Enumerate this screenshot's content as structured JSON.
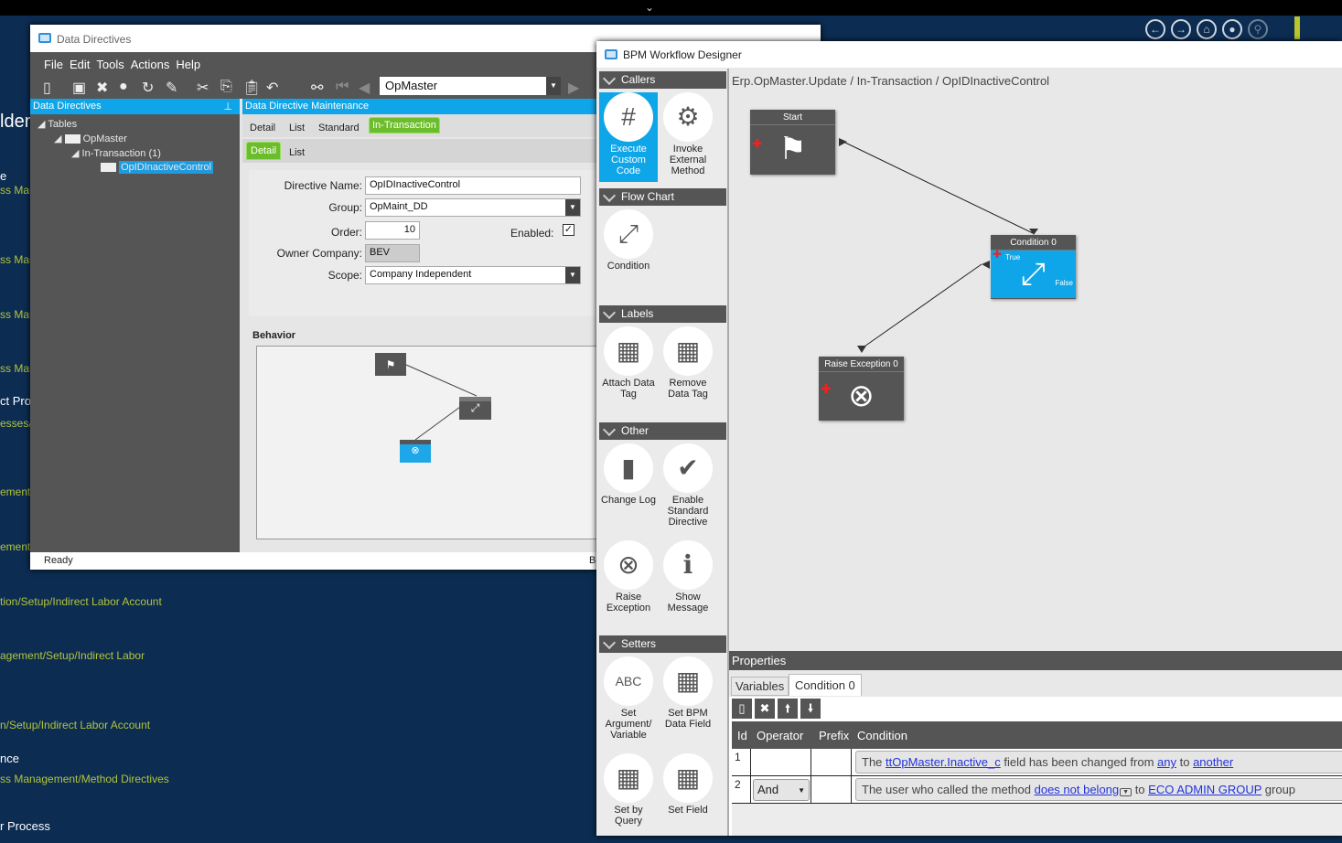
{
  "background": {
    "items": [
      {
        "text": "lders",
        "style": "heading"
      },
      {
        "text": "e",
        "style": "white"
      },
      {
        "text": "ss Man",
        "style": "green"
      },
      {
        "text": "ss Man",
        "style": "green"
      },
      {
        "text": "ss Man",
        "style": "green"
      },
      {
        "text": "ss Man",
        "style": "green"
      },
      {
        "text": "ct Pro",
        "style": "white"
      },
      {
        "text": "esses/E",
        "style": "green"
      },
      {
        "text": "ement/",
        "style": "green"
      },
      {
        "text": "ement/",
        "style": "green"
      },
      {
        "text": "tion/Setup/Indirect Labor Account",
        "style": "green"
      },
      {
        "text": "agement/Setup/Indirect Labor",
        "style": "green"
      },
      {
        "text": "n/Setup/Indirect Labor Account",
        "style": "green"
      },
      {
        "text": "nce",
        "style": "white"
      },
      {
        "text": "ss Management/Method Directives",
        "style": "green"
      },
      {
        "text": "r Process",
        "style": "white"
      }
    ]
  },
  "data_directives": {
    "title": "Data Directives",
    "menu": [
      "File",
      "Edit",
      "Tools",
      "Actions",
      "Help"
    ],
    "toolbar_combo": "OpMaster",
    "left_header": "Data Directives",
    "tree": [
      "Tables",
      "OpMaster",
      "In-Transaction (1)",
      "OpIDInactiveControl"
    ],
    "right_header": "Data Directive Maintenance",
    "tabs": [
      "Detail",
      "List",
      "Standard",
      "In-Transaction"
    ],
    "subtabs": [
      "Detail",
      "List"
    ],
    "form": {
      "directive_name_label": "Directive Name:",
      "directive_name": "OpIDInactiveControl",
      "group_label": "Group:",
      "group": "OpMaint_DD",
      "order_label": "Order:",
      "order": "10",
      "enabled_label": "Enabled:",
      "enabled": true,
      "owner_label": "Owner Company:",
      "owner": "BEV",
      "scope_label": "Scope:",
      "scope": "Company Independent"
    },
    "behavior_label": "Behavior",
    "status": "Ready",
    "status_right": "B"
  },
  "bpm": {
    "title": "BPM Workflow Designer",
    "breadcrumb": "Erp.OpMaster.Update / In-Transaction / OpIDInactiveControl",
    "sections": [
      {
        "name": "Callers",
        "tools": [
          "Execute Custom Code",
          "Invoke External Method"
        ]
      },
      {
        "name": "Flow Chart",
        "tools": [
          "Condition"
        ]
      },
      {
        "name": "Labels",
        "tools": [
          "Attach Data Tag",
          "Remove Data Tag"
        ]
      },
      {
        "name": "Other",
        "tools": [
          "Change Log",
          "Enable Standard Directive",
          "Raise Exception",
          "Show Message"
        ]
      },
      {
        "name": "Setters",
        "tools": [
          "Set Argument/ Variable",
          "Set BPM Data Field",
          "Set by Query",
          "Set Field"
        ]
      }
    ],
    "nodes": {
      "start": "Start",
      "condition": "Condition 0",
      "true_label": "True",
      "false_label": "False",
      "exception": "Raise Exception 0"
    },
    "properties": {
      "header": "Properties",
      "tabs": [
        "Variables",
        "Condition 0"
      ],
      "columns": [
        "Id",
        "Operator",
        "Prefix",
        "Condition"
      ],
      "rows": [
        {
          "id": "1",
          "operator": "",
          "prefix": "",
          "pre": "The ",
          "l1": "ttOpMaster.Inactive_c",
          "mid1": " field has been changed from ",
          "l2": "any",
          "mid2": " to ",
          "l3": "another",
          "post": ""
        },
        {
          "id": "2",
          "operator": "And",
          "prefix": "",
          "pre": "The user who called the method ",
          "l1": "does not belong",
          "mid1": " to ",
          "l2": "ECO ADMIN GROUP",
          "mid2": " group",
          "l3": "",
          "post": ""
        }
      ]
    }
  },
  "colors": {
    "accent": "#0ea5e9",
    "green": "#6cbd2b",
    "background": "#0c2c52"
  }
}
